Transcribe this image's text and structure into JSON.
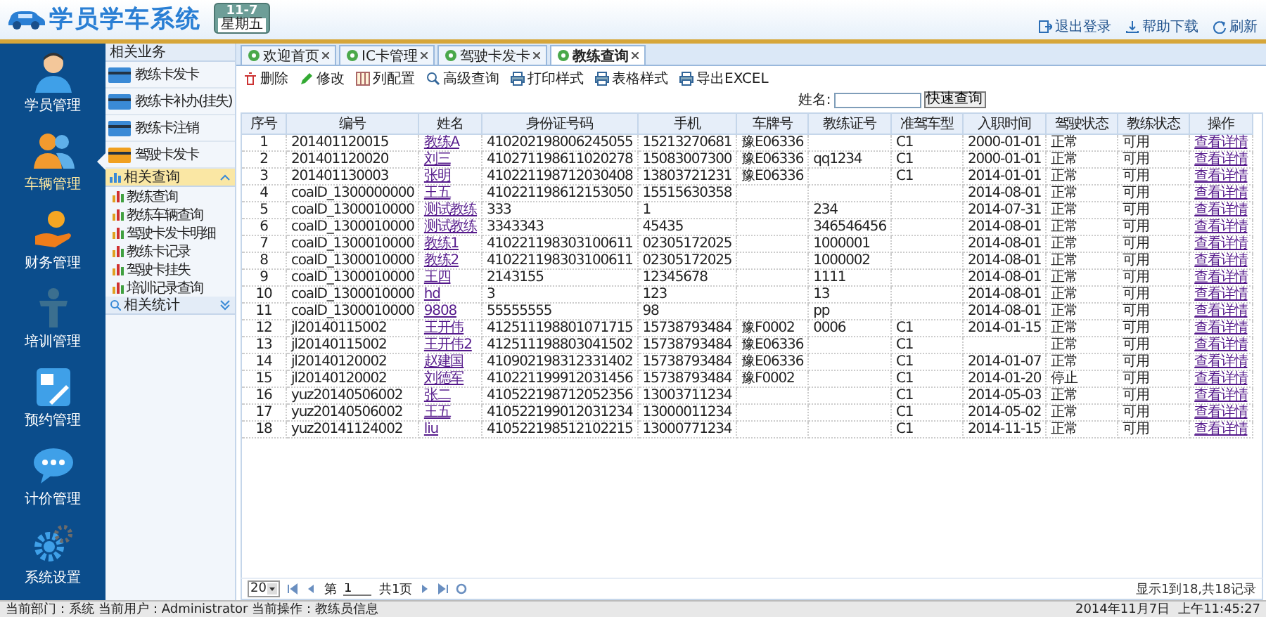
{
  "header": {
    "title": "学员学车系统",
    "date_badge": {
      "date": "11-7",
      "weekday": "星期五"
    },
    "links": [
      {
        "kind": "exit",
        "label": "退出登录"
      },
      {
        "kind": "download",
        "label": "帮助下载"
      },
      {
        "kind": "refresh",
        "label": "刷新"
      }
    ]
  },
  "nav": [
    {
      "label": "学员管理",
      "selected": false
    },
    {
      "label": "车辆管理",
      "selected": true
    },
    {
      "label": "财务管理",
      "selected": false
    },
    {
      "label": "培训管理",
      "selected": false
    },
    {
      "label": "预约管理",
      "selected": false
    },
    {
      "label": "计价管理",
      "selected": false
    },
    {
      "label": "系统设置",
      "selected": false
    }
  ],
  "subpanel": {
    "groups": [
      {
        "title": "相关业务",
        "kind": "cards",
        "expanded": true,
        "selected": false,
        "items": [
          "教练卡发卡",
          "教练卡补办(挂失)",
          "教练卡注销",
          "驾驶卡发卡"
        ]
      },
      {
        "title": "相关查询",
        "kind": "list",
        "expanded": true,
        "selected": true,
        "items": [
          "教练查询",
          "教练车辆查询",
          "驾驶卡发卡明细",
          "教练卡记录",
          "驾驶卡挂失",
          "培训记录查询"
        ]
      },
      {
        "title": "相关统计",
        "kind": "list",
        "expanded": false,
        "selected": false
      }
    ]
  },
  "tabs": [
    {
      "label": "欢迎首页",
      "selected": false
    },
    {
      "label": "IC卡管理",
      "selected": false
    },
    {
      "label": "驾驶卡发卡",
      "selected": false
    },
    {
      "label": "教练查询",
      "selected": true
    }
  ],
  "toolbar": [
    {
      "kind": "delete",
      "label": "删除"
    },
    {
      "kind": "edit",
      "label": "修改"
    },
    {
      "kind": "columns",
      "label": "列配置"
    },
    {
      "kind": "search",
      "label": "高级查询"
    },
    {
      "kind": "print",
      "label": "打印样式"
    },
    {
      "kind": "table",
      "label": "表格样式"
    },
    {
      "kind": "export",
      "label": "导出EXCEL"
    }
  ],
  "search": {
    "label": "姓名:",
    "button": "快速查询"
  },
  "table": {
    "columns": [
      {
        "label": "序号",
        "kind": "text"
      },
      {
        "label": "编号",
        "kind": "text"
      },
      {
        "label": "姓名",
        "kind": "link"
      },
      {
        "label": "身份证号码",
        "kind": "text"
      },
      {
        "label": "手机",
        "kind": "text"
      },
      {
        "label": "车牌号",
        "kind": "text"
      },
      {
        "label": "教练证号",
        "kind": "text"
      },
      {
        "label": "准驾车型",
        "kind": "text"
      },
      {
        "label": "入职时间",
        "kind": "text"
      },
      {
        "label": "驾驶状态",
        "kind": "text"
      },
      {
        "label": "教练状态",
        "kind": "text"
      },
      {
        "label": "操作",
        "kind": "link"
      }
    ],
    "rows": [
      [
        "1",
        "201401120015",
        "教练A",
        "410202198006245055",
        "15213270681",
        "豫E06336",
        "",
        "C1",
        "2000-01-01",
        "正常",
        "可用",
        "查看详情"
      ],
      [
        "2",
        "201401120020",
        "刘三",
        "410271198611020278",
        "15083007300",
        "豫E06336",
        "qq1234",
        "C1",
        "2000-01-01",
        "正常",
        "可用",
        "查看详情"
      ],
      [
        "3",
        "201401130003",
        "张明",
        "410221198712030408",
        "13803721231",
        "豫E06336",
        "",
        "C1",
        "2014-01-01",
        "正常",
        "可用",
        "查看详情"
      ],
      [
        "4",
        "coaID_1300000000",
        "王五",
        "410221198612153050",
        "15515630358",
        "",
        "",
        "",
        "2014-08-01",
        "正常",
        "可用",
        "查看详情"
      ],
      [
        "5",
        "coaID_1300010000",
        "测试教练",
        "333",
        "1",
        "",
        "234",
        "",
        "2014-07-31",
        "正常",
        "可用",
        "查看详情"
      ],
      [
        "6",
        "coaID_1300010000",
        "测试教练",
        "3343343",
        "45435",
        "",
        "346546456",
        "",
        "2014-08-01",
        "正常",
        "可用",
        "查看详情"
      ],
      [
        "7",
        "coaID_1300010000",
        "教练1",
        "410221198303100611",
        "02305172025",
        "",
        "1000001",
        "",
        "2014-08-01",
        "正常",
        "可用",
        "查看详情"
      ],
      [
        "8",
        "coaID_1300010000",
        "教练2",
        "410221198303100611",
        "02305172025",
        "",
        "1000002",
        "",
        "2014-08-01",
        "正常",
        "可用",
        "查看详情"
      ],
      [
        "9",
        "coaID_1300010000",
        "王四",
        "2143155",
        "12345678",
        "",
        "1111",
        "",
        "2014-08-01",
        "正常",
        "可用",
        "查看详情"
      ],
      [
        "10",
        "coaID_1300010000",
        "hd",
        "3",
        "123",
        "",
        "13",
        "",
        "2014-08-01",
        "正常",
        "可用",
        "查看详情"
      ],
      [
        "11",
        "coaID_1300010000",
        "9808",
        "55555555",
        "98",
        "",
        "pp",
        "",
        "2014-08-01",
        "正常",
        "可用",
        "查看详情"
      ],
      [
        "12",
        "jl20140115002",
        "王开伟",
        "412511198801071715",
        "15738793484",
        "豫F0002",
        "0006",
        "C1",
        "2014-01-15",
        "正常",
        "可用",
        "查看详情"
      ],
      [
        "13",
        "jl20140115002",
        "王开伟2",
        "412511198803041502",
        "15738793484",
        "豫E06336",
        "",
        "C1",
        "",
        "正常",
        "可用",
        "查看详情"
      ],
      [
        "14",
        "jl20140120002",
        "赵建国",
        "410902198312331402",
        "15738793484",
        "豫E06336",
        "",
        "C1",
        "2014-01-07",
        "正常",
        "可用",
        "查看详情"
      ],
      [
        "15",
        "jl20140120002",
        "刘德军",
        "410221199912031456",
        "15738793484",
        "豫F0002",
        "",
        "C1",
        "2014-01-20",
        "停止",
        "可用",
        "查看详情"
      ],
      [
        "16",
        "yuz20140506002",
        "张二",
        "410522198712052356",
        "13003711234",
        "",
        "",
        "C1",
        "2014-05-03",
        "正常",
        "可用",
        "查看详情"
      ],
      [
        "17",
        "yuz20140506002",
        "王五",
        "410522199012031234",
        "13000011234",
        "",
        "",
        "C1",
        "2014-05-02",
        "正常",
        "可用",
        "查看详情"
      ],
      [
        "18",
        "yuz20141124002",
        "liu",
        "410522198512102215",
        "13000771234",
        "",
        "",
        "C1",
        "2014-11-15",
        "正常",
        "可用",
        "查看详情"
      ]
    ]
  },
  "pager": {
    "page_size": "20",
    "page_label": "第",
    "page": "1",
    "total_pages": "共1页",
    "summary": "显示1到18,共18记录"
  },
  "status_bar": {
    "info": "当前部门：系统 当前用户：Administrator 当前操作：教练员信息",
    "date": "2014年11月7日",
    "time": "上午11:45:27"
  }
}
